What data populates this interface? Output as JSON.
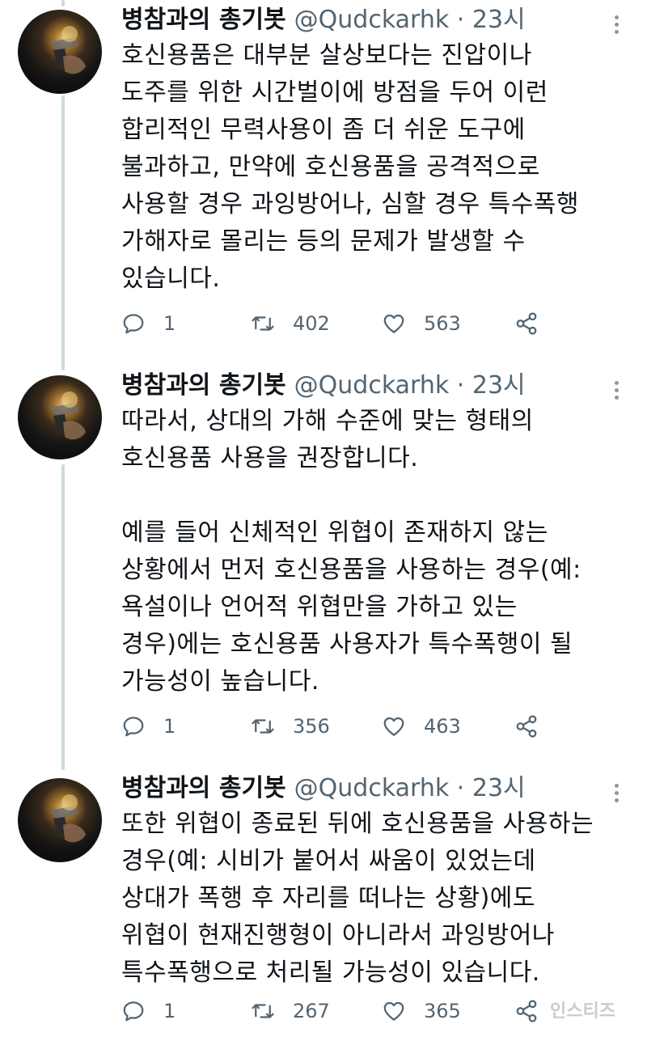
{
  "author": {
    "name": "병참과의 총기봇",
    "handle": "@Qudckarhk · 23시"
  },
  "tweets": [
    {
      "lines": [
        "호신용품은 대부분 살상보다는 진압이나",
        "도주를 위한 시간벌이에 방점을 두어 이런",
        "합리적인 무력사용이 좀 더 쉬운 도구에",
        "불과하고, 만약에 호신용품을 공격적으로",
        "사용할 경우 과잉방어나, 심할 경우 특수폭행",
        "가해자로 몰리는 등의 문제가 발생할 수",
        "있습니다."
      ],
      "replies": "1",
      "retweets": "402",
      "likes": "563"
    },
    {
      "lines": [
        "따라서, 상대의 가해 수준에 맞는 형태의",
        "호신용품 사용을 권장합니다.",
        "",
        "예를 들어 신체적인 위협이 존재하지 않는",
        "상황에서 먼저 호신용품을 사용하는 경우(예:",
        "욕설이나 언어적 위협만을 가하고 있는",
        "경우)에는 호신용품 사용자가 특수폭행이 될",
        "가능성이 높습니다."
      ],
      "replies": "1",
      "retweets": "356",
      "likes": "463"
    },
    {
      "lines": [
        "또한 위협이 종료된 뒤에 호신용품을 사용하는",
        "경우(예: 시비가 붙어서 싸움이 있었는데",
        "상대가 폭행 후 자리를 떠나는 상황)에도",
        "위협이 현재진행형이 아니라서 과잉방어나",
        "특수폭행으로 처리될 가능성이 있습니다."
      ],
      "replies": "1",
      "retweets": "267",
      "likes": "365"
    }
  ],
  "icons": {
    "reply": "reply-icon",
    "retweet": "retweet-icon",
    "like": "heart-icon",
    "share": "share-icon",
    "more": "more-icon"
  },
  "colors": {
    "text": "#0f1419",
    "secondary": "#536471",
    "thread_line": "#cfd9de"
  },
  "watermark": "인스티즈"
}
